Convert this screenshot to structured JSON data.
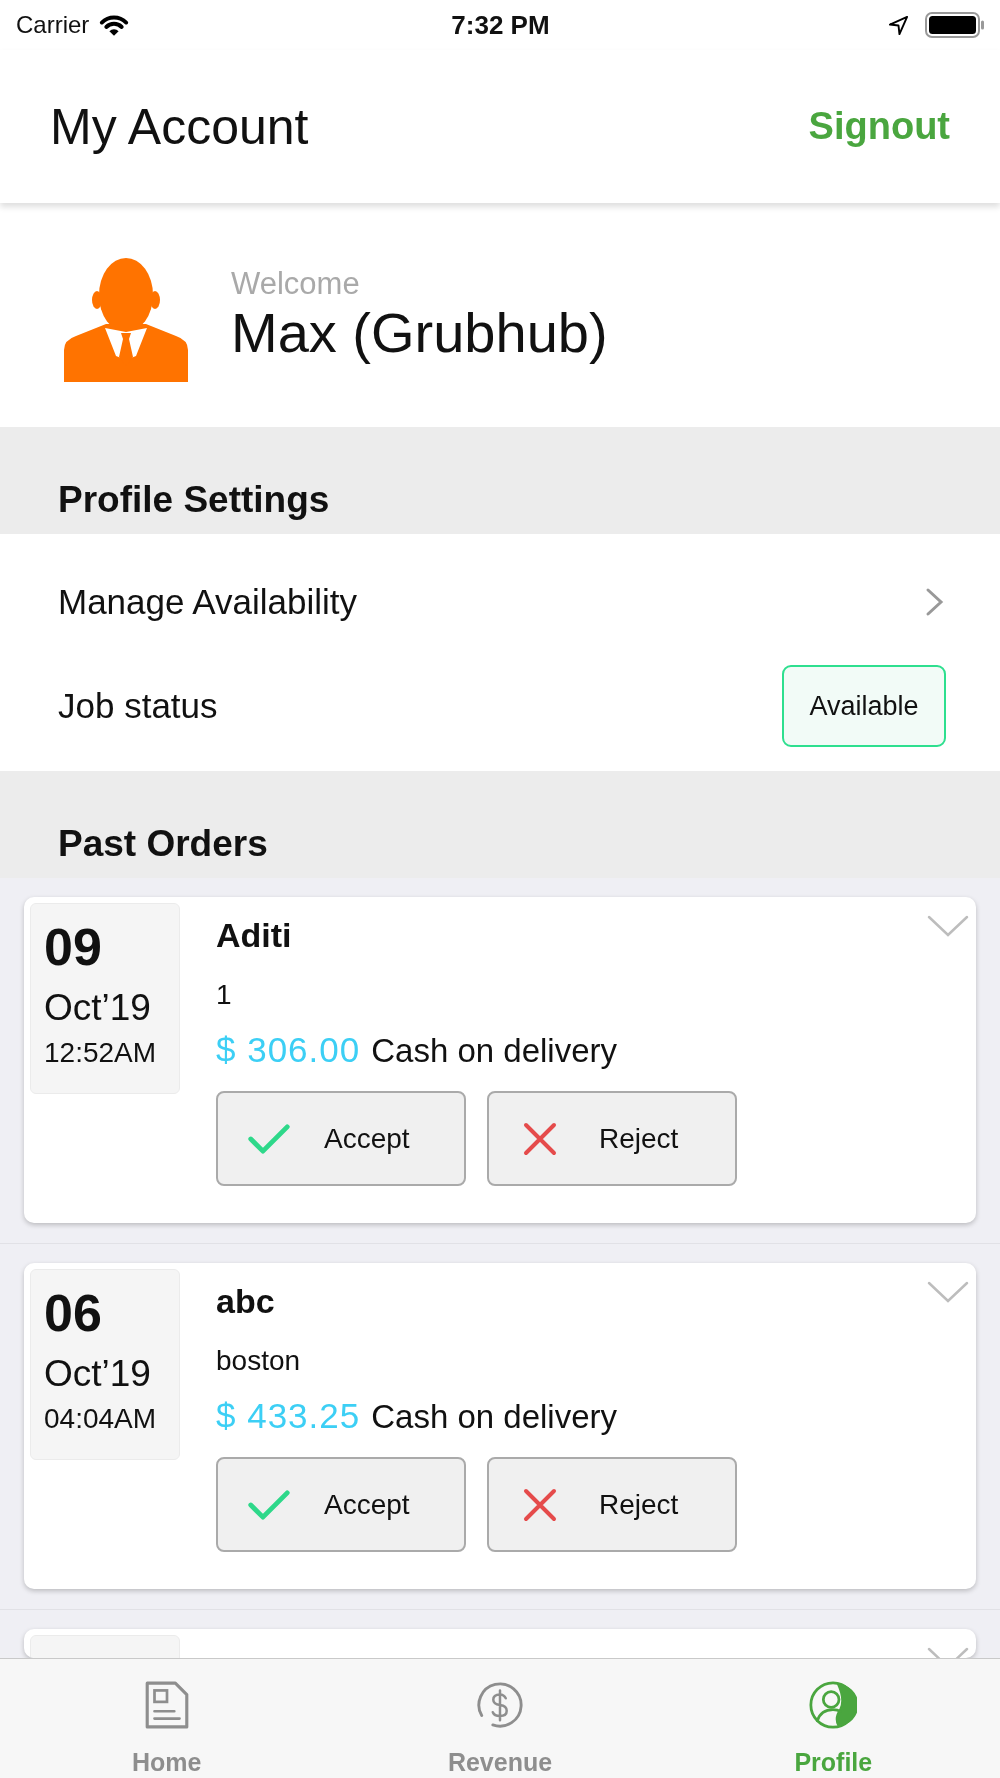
{
  "status_bar": {
    "carrier": "Carrier",
    "time": "7:32 PM"
  },
  "header": {
    "title": "My Account",
    "action": "Signout"
  },
  "profile": {
    "greeting": "Welcome",
    "name": "Max (Grubhub)"
  },
  "profile_settings": {
    "title": "Profile Settings",
    "items": [
      {
        "kind": "link",
        "label": "Manage Availability"
      },
      {
        "kind": "status",
        "label": "Job status",
        "value": "Available"
      }
    ]
  },
  "past_orders": {
    "title": "Past Orders",
    "orders": [
      {
        "day": "09",
        "month": "Oct’19",
        "time": "12:52AM",
        "customer": "Aditi",
        "address": "1",
        "amount": "$ 306.00",
        "payment": "Cash on delivery",
        "expanded": false,
        "actions": [
          {
            "kind": "accept",
            "label": "Accept"
          },
          {
            "kind": "reject",
            "label": "Reject"
          }
        ]
      },
      {
        "day": "06",
        "month": "Oct’19",
        "time": "04:04AM",
        "customer": "abc",
        "address": "boston",
        "amount": "$ 433.25",
        "payment": "Cash on delivery",
        "expanded": false,
        "actions": [
          {
            "kind": "accept",
            "label": "Accept"
          },
          {
            "kind": "reject",
            "label": "Reject"
          }
        ]
      },
      {
        "expanded": false
      }
    ]
  },
  "tab_bar": {
    "tabs": [
      {
        "kind": "home",
        "label": "Home",
        "selected": false
      },
      {
        "kind": "revenue",
        "label": "Revenue",
        "selected": false
      },
      {
        "kind": "profile",
        "label": "Profile",
        "selected": true
      }
    ]
  }
}
